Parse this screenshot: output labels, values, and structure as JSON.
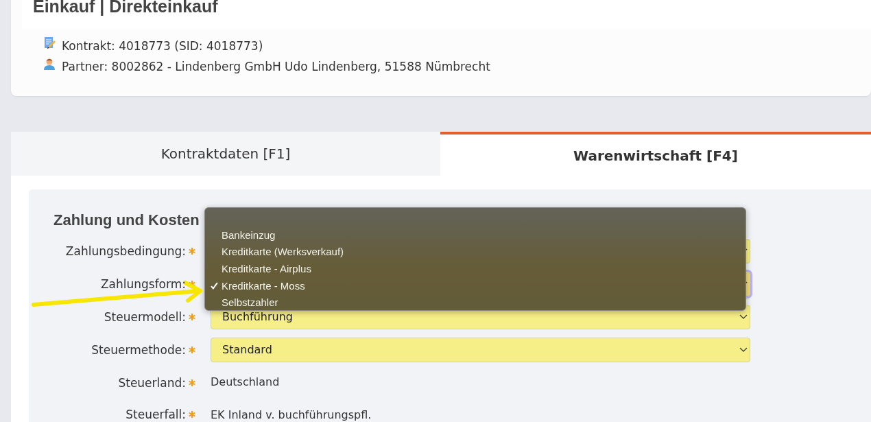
{
  "header": {
    "title": "Einkauf | Direkteinkauf",
    "info": [
      {
        "kind": "contract",
        "text": "Kontrakt: 4018773 (SID: 4018773)"
      },
      {
        "kind": "partner",
        "text": "Partner: 8002862 - Lindenberg GmbH Udo Lindenberg, 51588 Nümbrecht"
      }
    ]
  },
  "tabs": [
    {
      "label": "Kontraktdaten [F1]",
      "selected": false
    },
    {
      "label": "Warenwirtschaft [F4]",
      "selected": true
    }
  ],
  "section": {
    "title": "Zahlung und Kosten",
    "fields": [
      {
        "kind": "select",
        "label": "Zahlungsbedingung:",
        "required": true,
        "focused": false
      },
      {
        "kind": "select",
        "label": "Zahlungsform:",
        "required": true,
        "focused": true
      },
      {
        "kind": "select",
        "label": "Steuermodell:",
        "required": true,
        "focused": false,
        "value": "Buchführung"
      },
      {
        "kind": "select",
        "label": "Steuermethode:",
        "required": true,
        "focused": false,
        "value": "Standard"
      },
      {
        "kind": "text",
        "label": "Steuerland:",
        "required": true,
        "value": "Deutschland"
      },
      {
        "kind": "text",
        "label": "Steuerfall:",
        "required": true,
        "value": "EK Inland v. buchführungspfl."
      }
    ]
  },
  "dropdown": {
    "options": [
      {
        "label": "Bankeinzug",
        "selected": false
      },
      {
        "label": "Kreditkarte (Werksverkauf)",
        "selected": false
      },
      {
        "label": "Kreditkarte - Airplus",
        "selected": false
      },
      {
        "label": "Kreditkarte - Moss",
        "selected": true
      },
      {
        "label": "Selbstzahler",
        "selected": false
      }
    ]
  }
}
